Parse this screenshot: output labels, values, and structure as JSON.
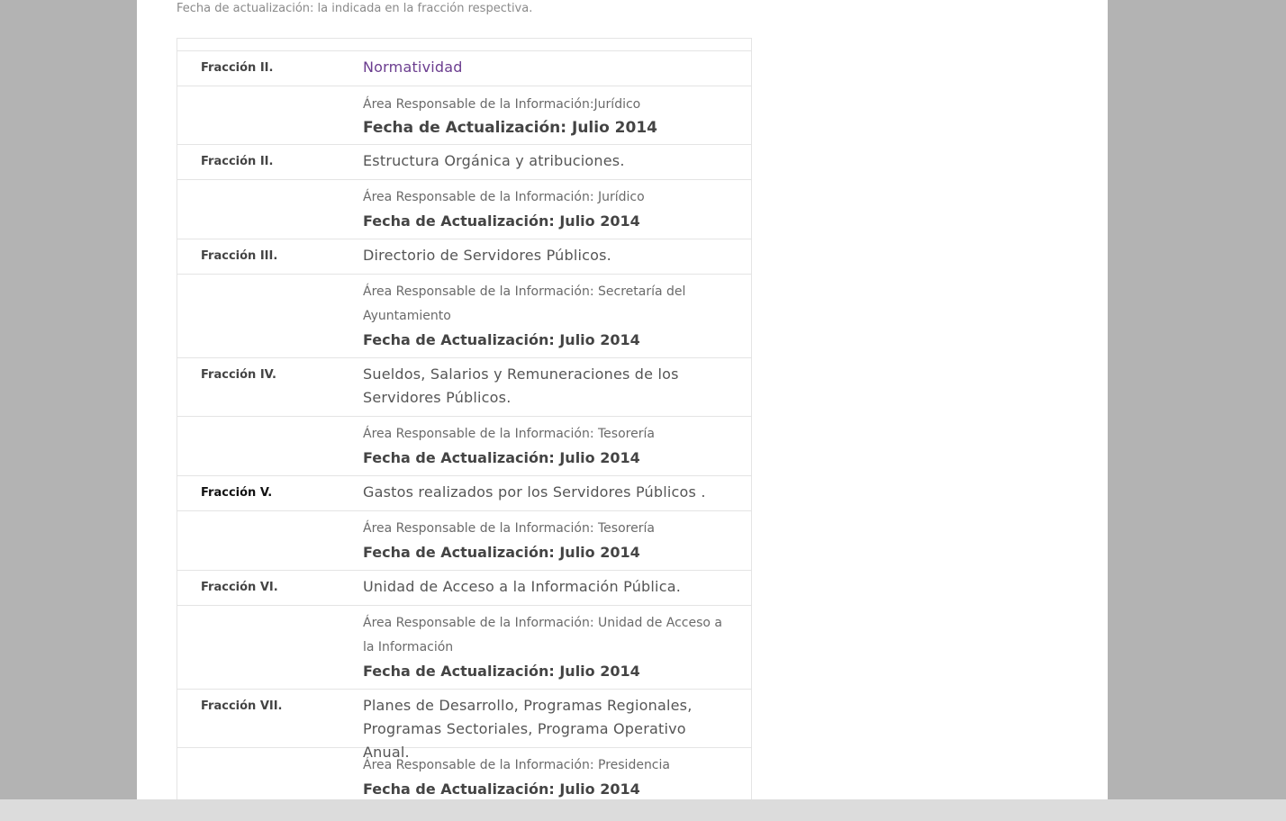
{
  "intro_text": "Fecha de actualización: la indicada en la fracción respectiva.",
  "rows": [
    {
      "fraccion": "Fracción II.",
      "title": "Normatividad",
      "area": "Área Responsable de la Información:Jurídico",
      "fecha": "Fecha de Actualización: Julio 2014"
    },
    {
      "fraccion": "Fracción II.",
      "title": "Estructura Orgánica y atribuciones.",
      "area": "Área Responsable de la Información: Jurídico",
      "fecha": "Fecha de Actualización: Julio 2014"
    },
    {
      "fraccion": "Fracción III.",
      "title": "Directorio de Servidores Públicos.",
      "area": "Área Responsable de la Información: Secretaría del Ayuntamiento",
      "fecha": "Fecha de Actualización: Julio 2014"
    },
    {
      "fraccion": "Fracción IV.",
      "title": "Sueldos, Salarios y Remuneraciones de los Servidores Públicos.",
      "area": "Área Responsable de la Información: Tesorería",
      "fecha": "Fecha de Actualización: Julio 2014"
    },
    {
      "fraccion": "Fracción V.",
      "title": "Gastos realizados por los Servidores Públicos .",
      "area": "Área Responsable de la Información: Tesorería",
      "fecha": "Fecha de Actualización: Julio 2014"
    },
    {
      "fraccion": "Fracción VI.",
      "title": "Unidad de Acceso a la Información Pública.",
      "area": "Área Responsable de la Información: Unidad de Acceso a la Información",
      "fecha": "Fecha de Actualización: Julio 2014"
    },
    {
      "fraccion": "Fracción VII.",
      "title": "Planes de Desarrollo, Programas Regionales, Programas Sectoriales, Programa Operativo Anual.",
      "area": "Área Responsable de la Información: Presidencia",
      "fecha": "Fecha de Actualización: Julio 2014"
    }
  ],
  "colors": {
    "link": "#6b3d8f",
    "background": "#b3b3b3",
    "border": "#e4e4e4"
  }
}
